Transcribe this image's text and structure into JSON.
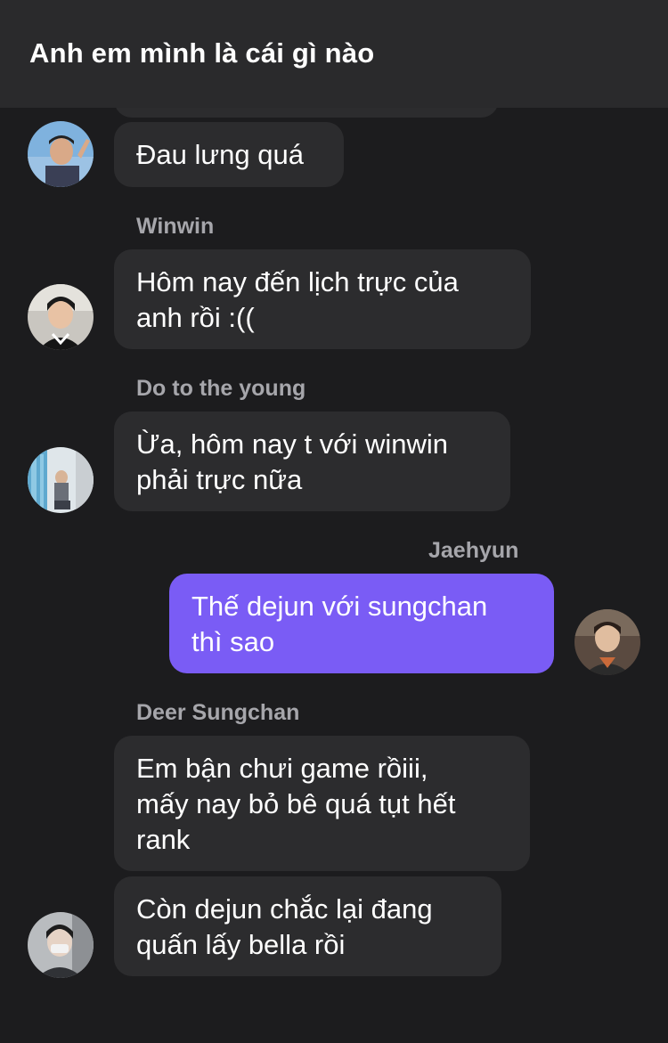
{
  "header": {
    "title": "Anh em mình là cái gì nào"
  },
  "messages": [
    {
      "sender": "",
      "text": "Đau lưng quá"
    },
    {
      "sender": "Winwin",
      "text": "Hôm nay đến lịch trực của\nanh rồi :(("
    },
    {
      "sender": "Do to the young",
      "text": "Ừa, hôm nay t với winwin\nphải trực nữa"
    },
    {
      "sender": "Jaehyun",
      "text": "Thế dejun với sungchan\nthì sao"
    },
    {
      "sender": "Deer Sungchan",
      "text": "Em bận chưi game rồiii,\nmấy nay bỏ bê quá tụt hết\nrank"
    },
    {
      "sender": "",
      "text": "Còn dejun chắc lại đang\nquấn lấy bella rồi"
    }
  ],
  "colors": {
    "background": "#1c1c1e",
    "header": "#2a2a2c",
    "incoming_bubble": "#2c2c2e",
    "outgoing_bubble": "#7a5cf5",
    "sender_name": "#a6a6ab"
  }
}
